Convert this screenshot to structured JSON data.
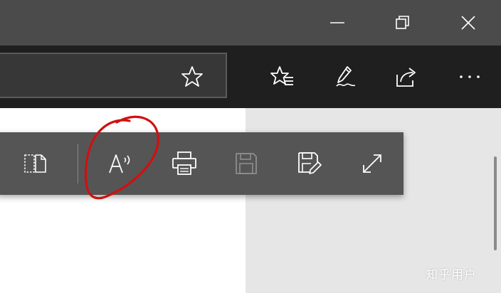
{
  "window_controls": {
    "minimize_icon": "minimize-icon",
    "restore_icon": "restore-icon",
    "close_icon": "close-icon"
  },
  "address_bar": {
    "value": "",
    "placeholder": "",
    "favorite_icon": "star-icon"
  },
  "nav_actions": [
    {
      "icon": "favorites-list-icon"
    },
    {
      "icon": "pen-icon"
    },
    {
      "icon": "share-icon"
    },
    {
      "icon": "more-icon"
    }
  ],
  "reading_toolbar": {
    "items": [
      {
        "icon": "page-view-icon",
        "enabled": true
      },
      {
        "icon": "read-aloud-icon",
        "enabled": true
      },
      {
        "icon": "printer-icon",
        "enabled": true
      },
      {
        "icon": "save-icon",
        "enabled": false
      },
      {
        "icon": "save-as-icon",
        "enabled": true
      },
      {
        "icon": "fullscreen-icon",
        "enabled": true
      }
    ]
  },
  "annotation": {
    "shape": "hand-drawn-circle",
    "color": "#d01010"
  },
  "colors": {
    "titlebar": "#4b4b4b",
    "navbar": "#1f1f1f",
    "toolbar": "#555555",
    "page_side": "#e6e6e6"
  },
  "watermark": {
    "text": "知乎用户"
  }
}
